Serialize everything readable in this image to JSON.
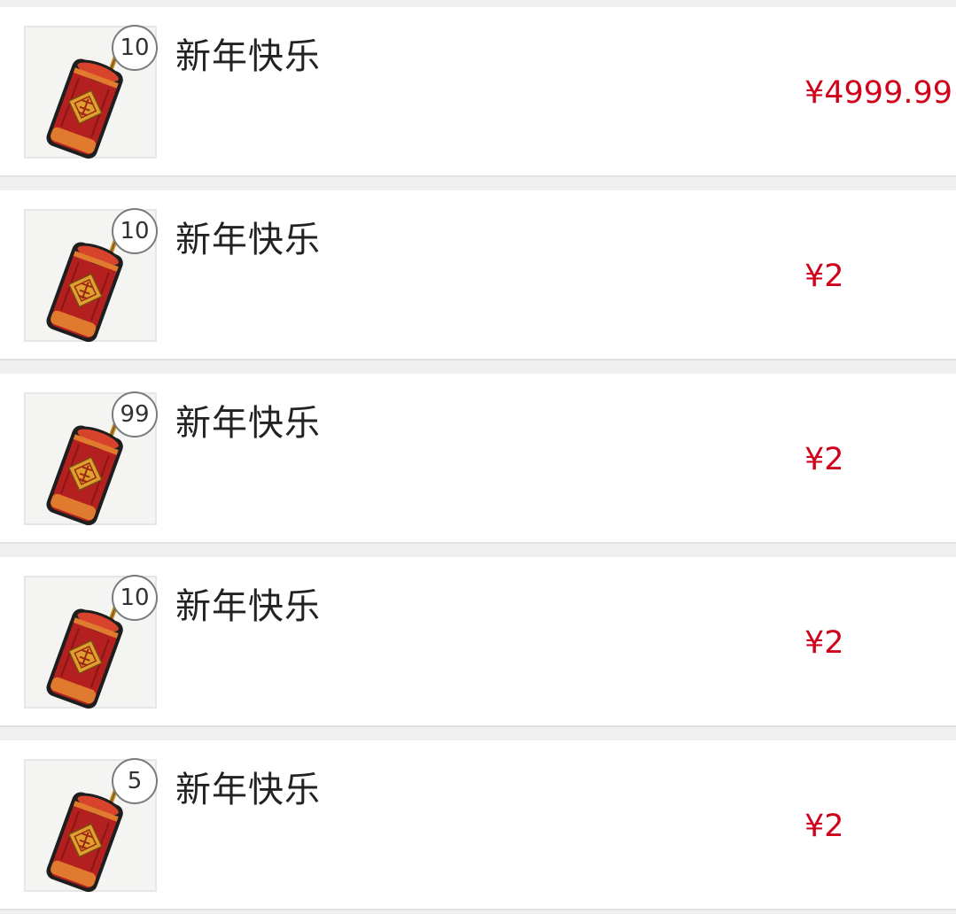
{
  "items": [
    {
      "title": "新年快乐",
      "quantity": "10",
      "price": "¥4999.99",
      "icon": "firecracker-icon"
    },
    {
      "title": "新年快乐",
      "quantity": "10",
      "price": "¥2",
      "icon": "firecracker-icon"
    },
    {
      "title": "新年快乐",
      "quantity": "99",
      "price": "¥2",
      "icon": "firecracker-icon"
    },
    {
      "title": "新年快乐",
      "quantity": "10",
      "price": "¥2",
      "icon": "firecracker-icon"
    },
    {
      "title": "新年快乐",
      "quantity": "5",
      "price": "¥2",
      "icon": "firecracker-icon"
    }
  ],
  "colors": {
    "price": "#d0021b",
    "background": "#f0f0f0",
    "card": "#ffffff",
    "firecracker_red": "#b3201f",
    "firecracker_gold": "#e0a030"
  }
}
